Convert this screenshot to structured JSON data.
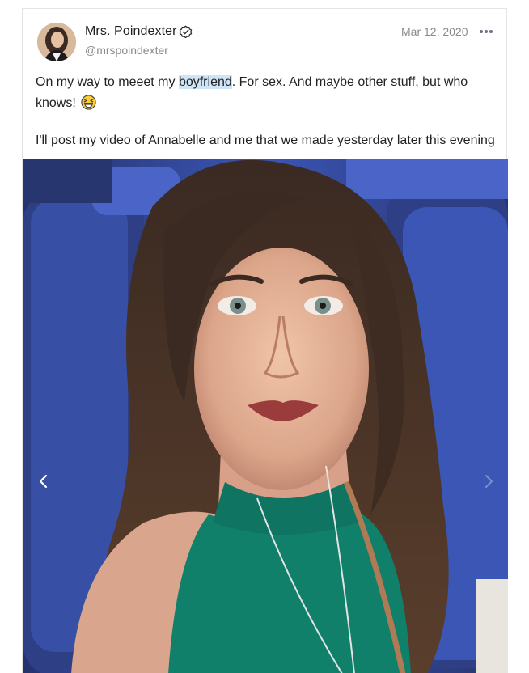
{
  "post": {
    "author": {
      "name": "Mrs. Poindexter",
      "handle": "@mrspoindexter",
      "verified_icon": "verified-check-icon",
      "avatar": "profile-photo"
    },
    "date": "Mar 12, 2020",
    "more_icon": "more-options-icon",
    "text": {
      "line1_before": "On my way to meeet my ",
      "highlighted_word": "boyfriend",
      "line1_after": ". For sex. And maybe other stuff, but who knows! ",
      "emoji_icon": "grinning-squinting-face-emoji",
      "paragraph2": "I'll post my video of Annabelle and me that we made yesterday later this evening"
    },
    "media": {
      "description_icon": "selfie-photo",
      "prev_icon": "chevron-left-icon",
      "next_icon": "chevron-right-icon"
    }
  },
  "colors": {
    "highlight": "#cfe4f6",
    "seat_blue": "#2b3f86",
    "top_green": "#11806a"
  }
}
